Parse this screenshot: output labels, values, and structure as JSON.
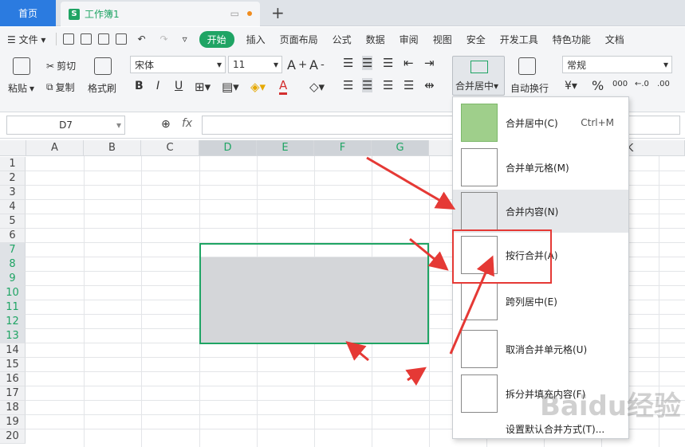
{
  "tabs": {
    "home": "首页",
    "doc": "工作簿1",
    "doc_icon": "S"
  },
  "menu": {
    "file": "文件",
    "start": "开始",
    "items": [
      "插入",
      "页面布局",
      "公式",
      "数据",
      "审阅",
      "视图",
      "安全",
      "开发工具",
      "特色功能",
      "文档"
    ]
  },
  "ribbon": {
    "paste": "粘贴",
    "cut": "剪切",
    "copy": "复制",
    "format_painter": "格式刷",
    "font_name": "宋体",
    "font_size": "11",
    "merge_center": "合并居中",
    "auto_wrap": "自动换行",
    "number_format": "常规",
    "bold": "B",
    "italic": "I",
    "underline": "U",
    "percent": "%",
    "thousands": "000"
  },
  "formula": {
    "name_box": "D7",
    "fx": "fx"
  },
  "columns": [
    "A",
    "B",
    "C",
    "D",
    "E",
    "F",
    "G",
    "K"
  ],
  "rows": [
    "1",
    "2",
    "3",
    "4",
    "5",
    "6",
    "7",
    "8",
    "9",
    "10",
    "11",
    "12",
    "13",
    "14",
    "15",
    "16",
    "17",
    "18",
    "19",
    "20"
  ],
  "dropdown": {
    "items": [
      {
        "label": "合并居中(C)",
        "shortcut": "Ctrl+M"
      },
      {
        "label": "合并单元格(M)",
        "shortcut": ""
      },
      {
        "label": "合并内容(N)",
        "shortcut": ""
      },
      {
        "label": "按行合并(A)",
        "shortcut": ""
      },
      {
        "label": "跨列居中(E)",
        "shortcut": ""
      },
      {
        "label": "取消合并单元格(U)",
        "shortcut": ""
      },
      {
        "label": "拆分并填充内容(F)",
        "shortcut": ""
      },
      {
        "label": "设置默认合并方式(T)...",
        "shortcut": ""
      }
    ]
  },
  "watermark": "Baidu经验",
  "colors": {
    "accent": "#1fa464",
    "home_tab": "#2b7be0",
    "annotation": "#e53935"
  }
}
